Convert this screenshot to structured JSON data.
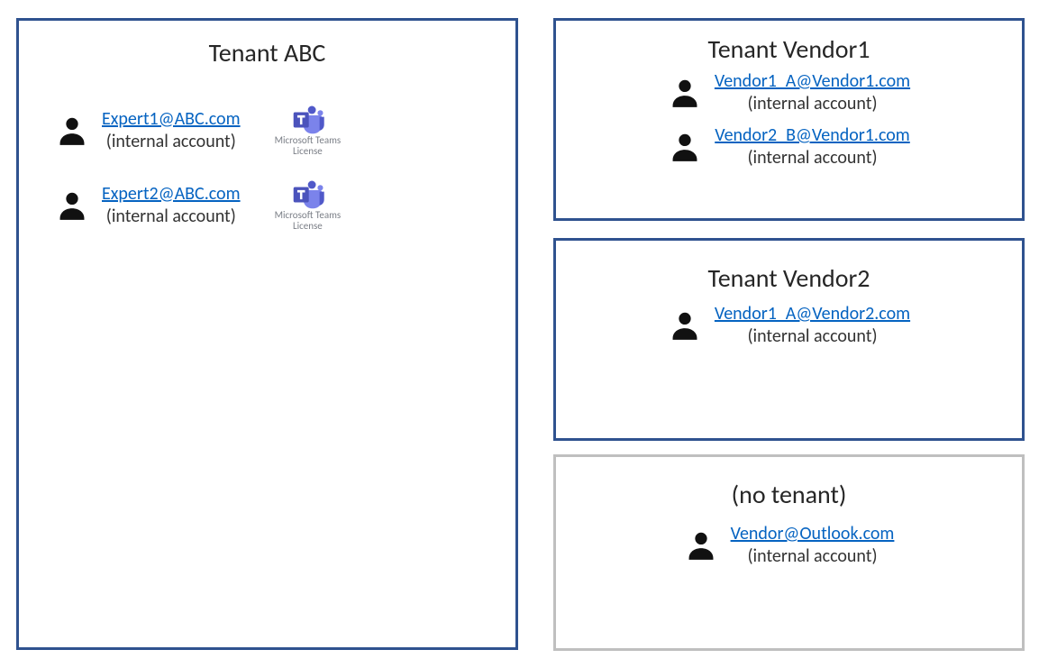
{
  "tenants": {
    "abc": {
      "title": "Tenant ABC",
      "users": [
        {
          "email": "Expert1@ABC.com",
          "note": "(internal account)",
          "teams_label_1": "Microsoft Teams",
          "teams_label_2": "License"
        },
        {
          "email": "Expert2@ABC.com",
          "note": "(internal account)",
          "teams_label_1": "Microsoft Teams",
          "teams_label_2": "License"
        }
      ]
    },
    "vendor1": {
      "title": "Tenant Vendor1",
      "users": [
        {
          "email": "Vendor1_A@Vendor1.com",
          "note": "(internal account)"
        },
        {
          "email": "Vendor2_B@Vendor1.com",
          "note": "(internal account)"
        }
      ]
    },
    "vendor2": {
      "title": "Tenant Vendor2",
      "users": [
        {
          "email": "Vendor1_A@Vendor2.com",
          "note": "(internal account)"
        }
      ]
    },
    "none": {
      "title": "(no tenant)",
      "users": [
        {
          "email": "Vendor@Outlook.com",
          "note": "(internal account)"
        }
      ]
    }
  }
}
